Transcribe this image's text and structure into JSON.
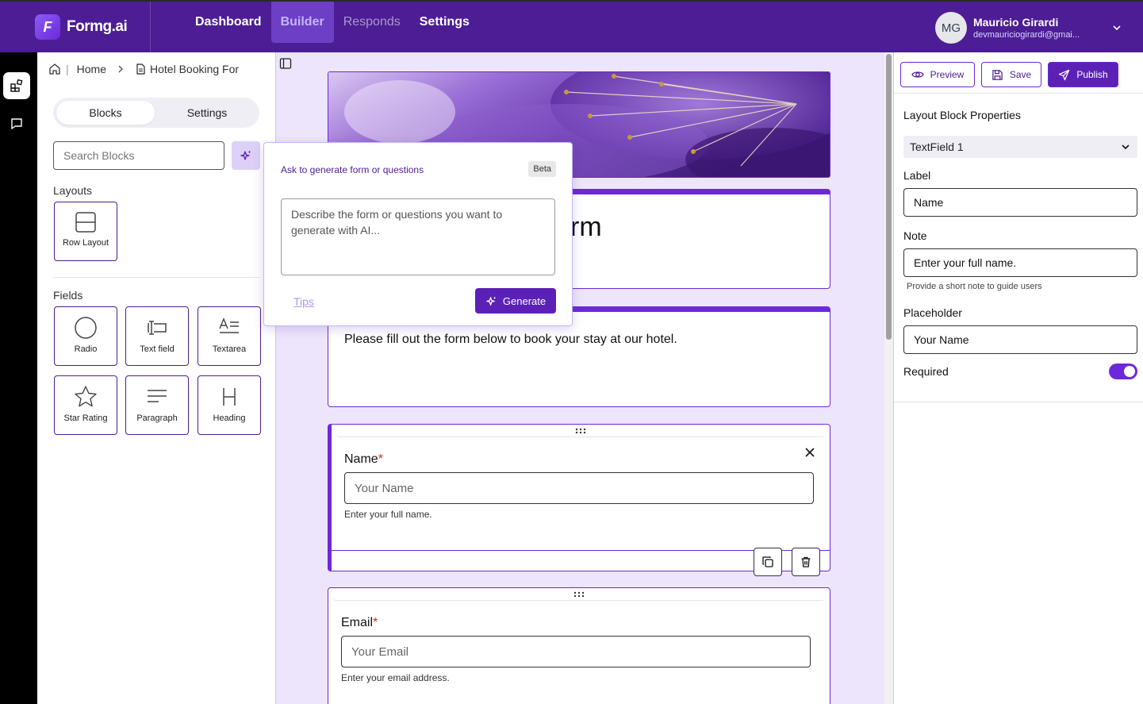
{
  "app": {
    "logo_letter": "F",
    "name": "Formg.ai"
  },
  "nav": {
    "items": [
      {
        "label": "Dashboard",
        "state": "normal"
      },
      {
        "label": "Builder",
        "state": "active"
      },
      {
        "label": "Responds",
        "state": "muted"
      },
      {
        "label": "Settings",
        "state": "normal"
      }
    ]
  },
  "user": {
    "initials": "MG",
    "name": "Mauricio Girardi",
    "email": "devmauriciogirardi@gmai..."
  },
  "breadcrumb": {
    "home": "Home",
    "current": "Hotel Booking For"
  },
  "left_panel": {
    "tabs": [
      "Blocks",
      "Settings"
    ],
    "search_placeholder": "Search Blocks",
    "layouts_label": "Layouts",
    "layouts": [
      {
        "label": "Row Layout",
        "icon": "row-layout-icon"
      }
    ],
    "fields_label": "Fields",
    "fields": [
      {
        "label": "Radio",
        "icon": "radio-icon"
      },
      {
        "label": "Text field",
        "icon": "text-field-icon"
      },
      {
        "label": "Textarea",
        "icon": "textarea-icon"
      },
      {
        "label": "Star Rating",
        "icon": "star-icon"
      },
      {
        "label": "Paragraph",
        "icon": "paragraph-icon"
      },
      {
        "label": "Heading",
        "icon": "heading-icon"
      }
    ]
  },
  "ai_popover": {
    "title": "Ask to generate form or questions",
    "badge": "Beta",
    "placeholder": "Describe the form or questions you want to generate with AI...",
    "tips": "Tips",
    "generate": "Generate"
  },
  "canvas": {
    "title_fragment": "rm",
    "description": "Please fill out the form below to book your stay at our hotel.",
    "fields": [
      {
        "label": "Name",
        "required_mark": "*",
        "placeholder": "Your Name",
        "note": "Enter your full name."
      },
      {
        "label": "Email",
        "required_mark": "*",
        "placeholder": "Your Email",
        "note": "Enter your email address."
      }
    ]
  },
  "right_panel": {
    "buttons": {
      "preview": "Preview",
      "save": "Save",
      "publish": "Publish"
    },
    "title": "Layout Block Properties",
    "selected_block": "TextField 1",
    "label_title": "Label",
    "label_value": "Name",
    "note_title": "Note",
    "note_value": "Enter your full name.",
    "note_hint": "Provide a short note to guide users",
    "placeholder_title": "Placeholder",
    "placeholder_value": "Your Name",
    "required_title": "Required",
    "required_on": true
  },
  "colors": {
    "brand": "#4c1d95",
    "accent": "#6d28d9",
    "canvas": "#ede5fb"
  }
}
